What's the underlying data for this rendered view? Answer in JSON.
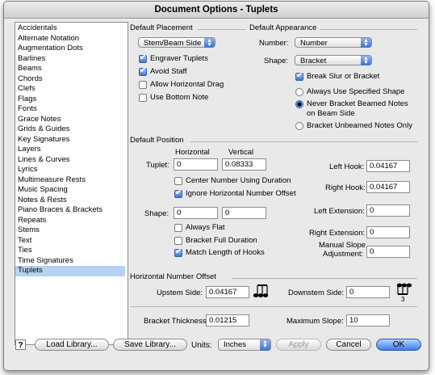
{
  "window": {
    "title": "Document Options - Tuplets"
  },
  "categories": [
    {
      "label": "Accidentals"
    },
    {
      "label": "Alternate Notation"
    },
    {
      "label": "Augmentation Dots"
    },
    {
      "label": "Barlines"
    },
    {
      "label": "Beams"
    },
    {
      "label": "Chords"
    },
    {
      "label": "Clefs"
    },
    {
      "label": "Flags"
    },
    {
      "label": "Fonts"
    },
    {
      "label": "Grace Notes"
    },
    {
      "label": "Grids & Guides"
    },
    {
      "label": "Key Signatures"
    },
    {
      "label": "Layers"
    },
    {
      "label": "Lines & Curves"
    },
    {
      "label": "Lyrics"
    },
    {
      "label": "Multimeasure Rests"
    },
    {
      "label": "Music Spacing"
    },
    {
      "label": "Notes & Rests"
    },
    {
      "label": "Piano Braces & Brackets"
    },
    {
      "label": "Repeats"
    },
    {
      "label": "Stems"
    },
    {
      "label": "Text"
    },
    {
      "label": "Ties"
    },
    {
      "label": "Time Signatures"
    },
    {
      "label": "Tuplets",
      "selected": true
    }
  ],
  "default_placement": {
    "title": "Default Placement",
    "placement_value": "Stem/Beam Side",
    "engraver_tuplets": {
      "label": "Engraver Tuplets",
      "checked": true
    },
    "avoid_staff": {
      "label": "Avoid Staff",
      "checked": true
    },
    "allow_horizontal_drag": {
      "label": "Allow Horizontal Drag",
      "checked": false
    },
    "use_bottom_note": {
      "label": "Use Bottom Note",
      "checked": false
    }
  },
  "default_appearance": {
    "title": "Default Appearance",
    "number_label": "Number:",
    "number_value": "Number",
    "shape_label": "Shape:",
    "shape_value": "Bracket",
    "break_slur": {
      "label": "Break Slur or Bracket",
      "checked": true
    },
    "radio_always": {
      "label": "Always Use Specified Shape",
      "selected": false
    },
    "radio_never_line1": "Never Bracket Beamed Notes",
    "radio_never_line2": "on Beam Side",
    "radio_never_selected": true,
    "radio_unbeamed": {
      "label": "Bracket Unbeamed Notes Only",
      "selected": false
    }
  },
  "default_position": {
    "title": "Default Position",
    "horizontal_header": "Horizontal",
    "vertical_header": "Vertical",
    "tuplet_label": "Tuplet:",
    "tuplet_h": "0",
    "tuplet_v": "0.08333",
    "center_number": {
      "label": "Center Number Using Duration",
      "checked": false
    },
    "ignore_offset": {
      "label": "Ignore Horizontal Number Offset",
      "checked": true
    },
    "shape_label": "Shape:",
    "shape_h": "0",
    "shape_v": "0",
    "always_flat": {
      "label": "Always Flat",
      "checked": false
    },
    "bracket_full": {
      "label": "Bracket Full Duration",
      "checked": false
    },
    "match_hooks": {
      "label": "Match Length of Hooks",
      "checked": true
    },
    "left_hook_label": "Left Hook:",
    "left_hook": "0.04167",
    "right_hook_label": "Right Hook:",
    "right_hook": "0.04167",
    "left_ext_label": "Left Extension:",
    "left_ext": "0",
    "right_ext_label": "Right Extension:",
    "right_ext": "0",
    "manual_slope_line1": "Manual Slope",
    "manual_slope_line2": "Adjustment:",
    "manual_slope": "0"
  },
  "horizontal_offset": {
    "title": "Horizontal Number Offset",
    "upstem_label": "Upstem Side:",
    "upstem": "0.04167",
    "downstem_label": "Downstem Side:",
    "downstem": "0",
    "downstem_icon_digit": "3"
  },
  "bottom_fields": {
    "bracket_thickness_label": "Bracket Thickness:",
    "bracket_thickness": "0.01215",
    "max_slope_label": "Maximum Slope:",
    "max_slope": "10"
  },
  "footer": {
    "help": "?",
    "load_library": "Load Library...",
    "save_library": "Save Library...",
    "units_label": "Units:",
    "units_value": "Inches",
    "apply": "Apply",
    "cancel": "Cancel",
    "ok": "OK"
  }
}
